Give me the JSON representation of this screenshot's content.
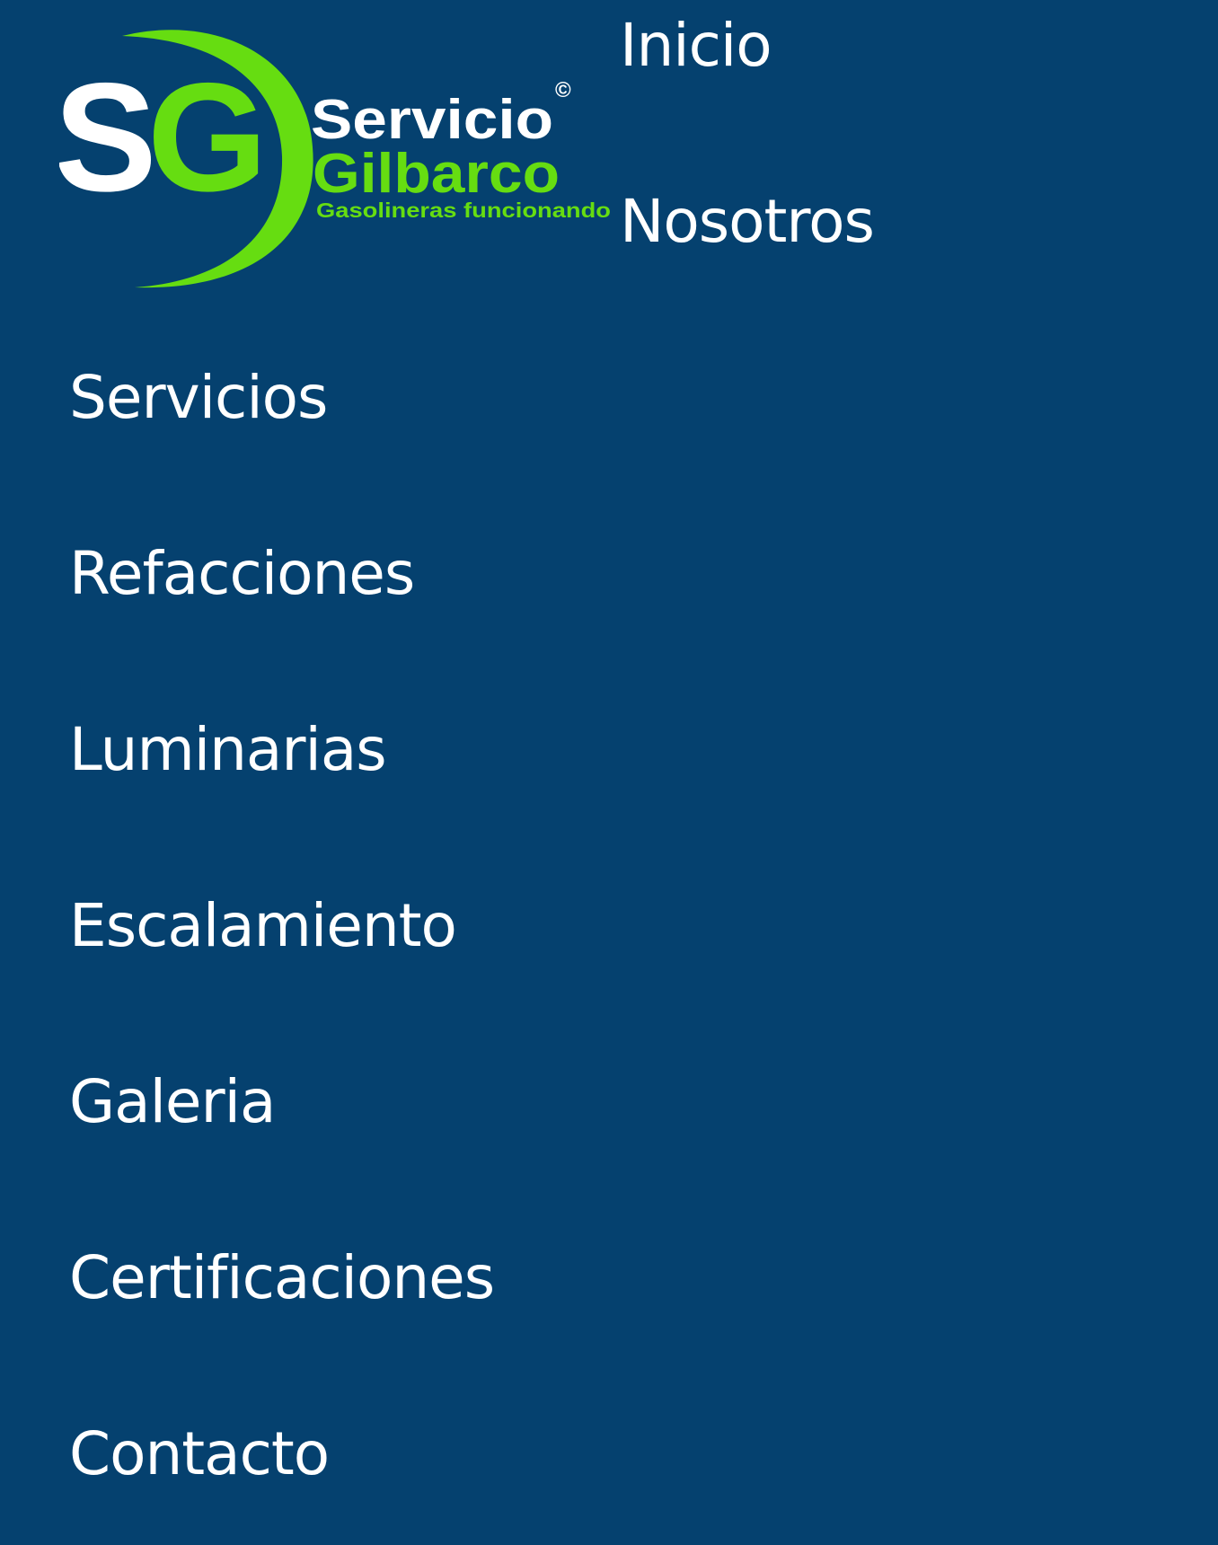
{
  "brand": {
    "initials_s": "S",
    "initials_g": "G",
    "name_line1": "Servicio",
    "name_line2": "Gilbarco",
    "tagline": "Gasolineras funcionando",
    "copyright": "©",
    "colors": {
      "background": "#05416f",
      "accent_green": "#66dd11",
      "text_white": "#ffffff"
    }
  },
  "nav": {
    "items": [
      {
        "label": "Inicio"
      },
      {
        "label": "Nosotros"
      },
      {
        "label": "Servicios"
      },
      {
        "label": "Refacciones"
      },
      {
        "label": "Luminarias"
      },
      {
        "label": "Escalamiento"
      },
      {
        "label": "Galeria"
      },
      {
        "label": "Certificaciones"
      },
      {
        "label": "Contacto"
      }
    ]
  }
}
